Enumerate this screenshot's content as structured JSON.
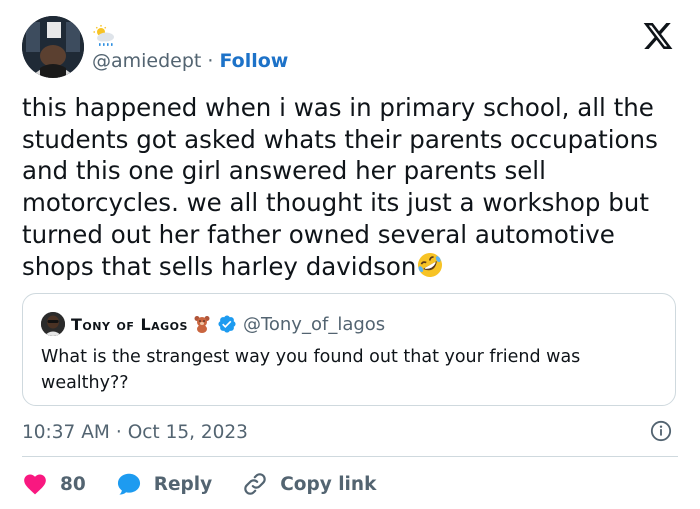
{
  "author": {
    "handle": "@amiedept",
    "separator": "·",
    "follow_label": "Follow"
  },
  "tweet": {
    "text": "this happened when i was in primary school, all the students got asked whats their parents occupations and this one girl answered her parents sell motorcycles. we all thought its just a workshop but turned out her father owned several automotive shops that sells harley davidson",
    "emoji_name": "rolling-on-floor-laughing-emoji"
  },
  "quoted": {
    "name": "Tony of Lagos",
    "handle": "@Tony_of_lagos",
    "text": "What is the strangest way you found out that your friend was wealthy??"
  },
  "meta": {
    "time": "10:37 AM",
    "separator": "·",
    "date": "Oct 15, 2023"
  },
  "actions": {
    "like_count": "80",
    "reply_label": "Reply",
    "copy_label": "Copy link"
  },
  "colors": {
    "accent": "#1d9bf0",
    "like": "#f91880",
    "text": "#0f1419",
    "muted": "#536471"
  }
}
